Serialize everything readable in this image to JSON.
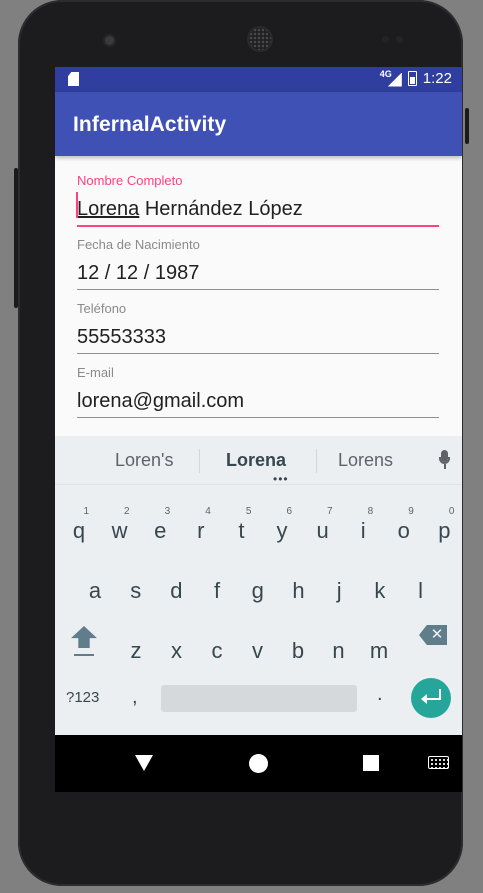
{
  "status_bar": {
    "network_label": "4G",
    "time": "1:22",
    "icons": [
      "sd-card-icon",
      "signal-icon",
      "battery-icon"
    ]
  },
  "app_bar": {
    "title": "InfernalActivity"
  },
  "form": {
    "full_name": {
      "label": "Nombre Completo",
      "value_first": "Lorena",
      "value_rest": " Hernández López"
    },
    "birth_date": {
      "label": "Fecha de Nacimiento",
      "value": "12 / 12 / 1987"
    },
    "phone": {
      "label": "Teléfono",
      "value": "55553333"
    },
    "email": {
      "label": "E-mail",
      "value": "lorena@gmail.com"
    }
  },
  "keyboard": {
    "suggestions": [
      "Loren's",
      "Lorena",
      "Lorens"
    ],
    "suggestion_more": "•••",
    "row1": [
      "q",
      "w",
      "e",
      "r",
      "t",
      "y",
      "u",
      "i",
      "o",
      "p"
    ],
    "row1_hints": [
      "1",
      "2",
      "3",
      "4",
      "5",
      "6",
      "7",
      "8",
      "9",
      "0"
    ],
    "row2": [
      "a",
      "s",
      "d",
      "f",
      "g",
      "h",
      "j",
      "k",
      "l"
    ],
    "row3": [
      "z",
      "x",
      "c",
      "v",
      "b",
      "n",
      "m"
    ],
    "backspace_glyph": "✕",
    "symbols_label": "?123",
    "comma": ",",
    "period": "."
  },
  "colors": {
    "status_bar": "#303f9f",
    "app_bar": "#3f51b5",
    "accent": "#ff4081",
    "enter_key": "#26a69a",
    "keyboard_bg": "#eceff1"
  }
}
